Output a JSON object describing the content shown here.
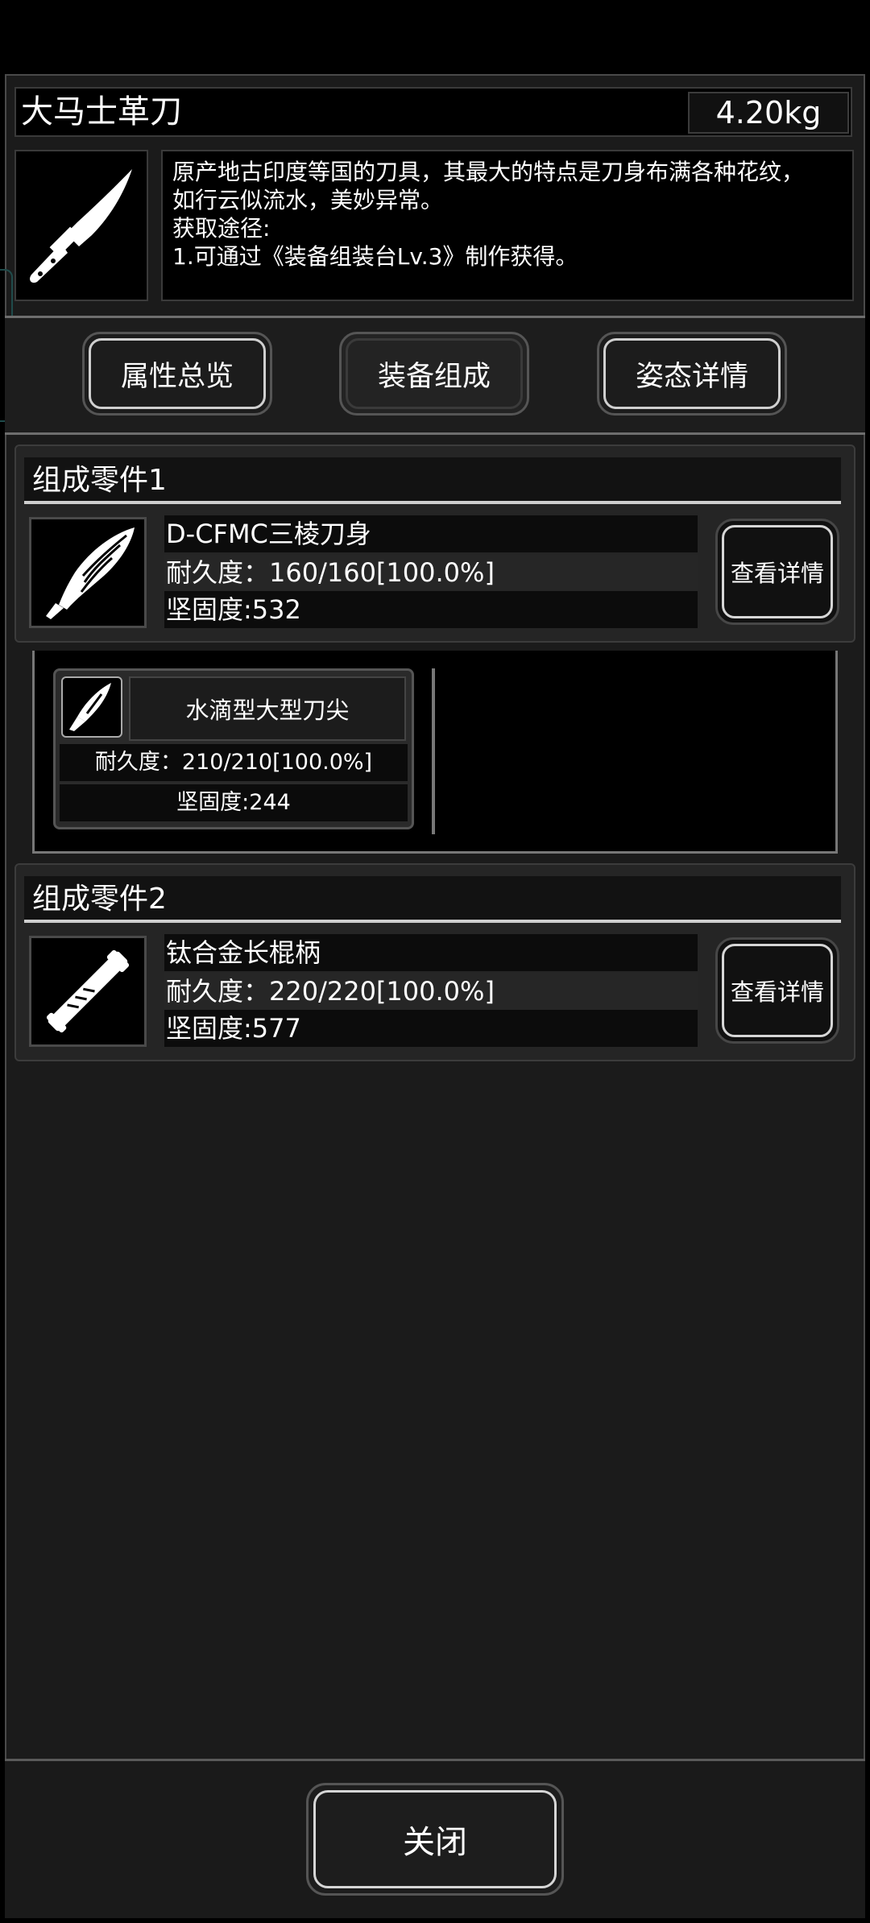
{
  "item": {
    "name": "大马士革刀",
    "weight": "4.20kg",
    "description_lines": [
      "原产地古印度等国的刀具，其最大的特点是刀身布满各种花纹，",
      "如行云似流水，美妙异常。",
      "获取途径:",
      "1.可通过《装备组装台Lv.3》制作获得。"
    ]
  },
  "tabs": [
    {
      "label": "属性总览",
      "active": false
    },
    {
      "label": "装备组成",
      "active": true
    },
    {
      "label": "姿态详情",
      "active": false
    }
  ],
  "parts": [
    {
      "header": "组成零件1",
      "name": "D-CFMC三棱刀身",
      "durability": "耐久度：160/160[100.0%]",
      "hardness": "坚固度:532",
      "detail_button": "查看详情",
      "icon": "blade-icon",
      "subparts": [
        {
          "name": "水滴型大型刀尖",
          "durability": "耐久度：210/210[100.0%]",
          "hardness": "坚固度:244",
          "icon": "blade-tip-icon"
        }
      ]
    },
    {
      "header": "组成零件2",
      "name": "钛合金长棍柄",
      "durability": "耐久度：220/220[100.0%]",
      "hardness": "坚固度:577",
      "detail_button": "查看详情",
      "icon": "handle-icon"
    }
  ],
  "close_button": "关闭",
  "colors": {
    "background": "#000000",
    "panel": "#1b1b1b",
    "button_border": "#d6d6d6",
    "text": "#ffffff"
  }
}
